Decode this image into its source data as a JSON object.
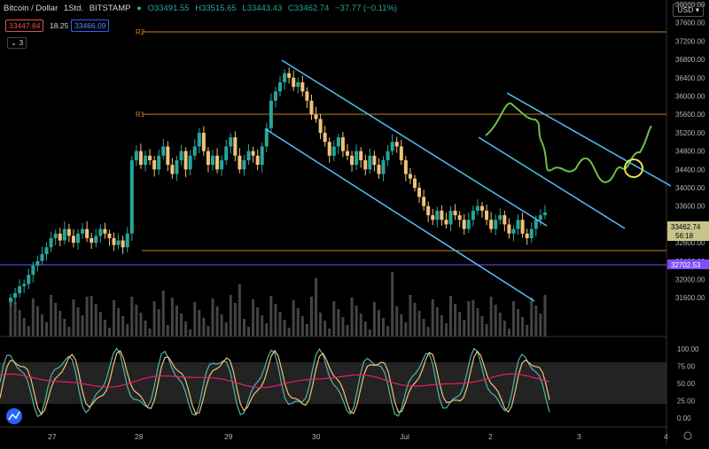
{
  "header": {
    "symbol": "Bitcoin / Dollar",
    "interval": "1Std.",
    "exchange": "BITSTAMP",
    "open": "O33491.55",
    "high": "H33515.65",
    "low": "L33443.43",
    "close": "C33462.74",
    "change": "−37.77 (−0.11%)"
  },
  "quote": {
    "bid": "33447.84",
    "spread": "18.25",
    "ask": "33466.09",
    "indicators_count": "3"
  },
  "currency": "USD",
  "levels": {
    "r2": "R2",
    "r1": "R1"
  },
  "price_axis": {
    "ticks": [
      "38000.00",
      "37600.00",
      "37200.00",
      "36800.00",
      "36400.00",
      "36000.00",
      "35600.00",
      "35200.00",
      "34800.00",
      "34400.00",
      "34000.00",
      "33600.00",
      "33200.00",
      "32800.00",
      "32400.00",
      "32000.00",
      "31600.00"
    ],
    "last_price": "33462.74",
    "countdown": "56:18",
    "line_price": "32702.53"
  },
  "osc_axis": {
    "ticks": [
      "100.00",
      "75.00",
      "50.00",
      "25.00",
      "0.00"
    ]
  },
  "time_axis": {
    "labels": [
      "27",
      "28",
      "29",
      "30",
      "Jul",
      "2",
      "3",
      "4"
    ]
  },
  "colors": {
    "up": "#26a69a",
    "down": "#f0c27b",
    "channel": "#4fc3f7",
    "drawing": "#6cc04a",
    "level": "#c77c2e",
    "purple": "#7c4dff"
  },
  "chart_data": {
    "type": "candlestick",
    "y_range": [
      31400,
      38000
    ],
    "candles_per_day": 24,
    "days": [
      "27",
      "28",
      "29",
      "30",
      "Jul",
      "2",
      "3",
      "4"
    ],
    "closes": [
      31600,
      31700,
      31850,
      31900,
      32100,
      32300,
      32400,
      32550,
      32700,
      32900,
      33000,
      32850,
      33100,
      32950,
      32800,
      33000,
      33100,
      32900,
      32800,
      32950,
      33100,
      33000,
      32900,
      32750,
      32850,
      32700,
      33000,
      34600,
      34800,
      34500,
      34700,
      34600,
      34400,
      34700,
      34900,
      34500,
      34300,
      34600,
      34800,
      34400,
      34700,
      34900,
      35200,
      34800,
      34500,
      34700,
      34400,
      34600,
      34900,
      35100,
      34700,
      34400,
      34600,
      34800,
      34700,
      34500,
      34900,
      35300,
      35900,
      36100,
      36300,
      36500,
      36400,
      36200,
      36300,
      36100,
      35900,
      35600,
      35500,
      35200,
      35000,
      34700,
      34900,
      35100,
      34800,
      34700,
      34500,
      34800,
      34600,
      34400,
      34700,
      34500,
      34300,
      34600,
      34800,
      35000,
      34900,
      34600,
      34300,
      34200,
      34000,
      33800,
      33600,
      33400,
      33300,
      33500,
      33300,
      33200,
      33500,
      33400,
      33300,
      33100,
      33300,
      33500,
      33600,
      33500,
      33300,
      33100,
      33300,
      33400,
      33200,
      33000,
      33100,
      33300,
      33000,
      32900,
      33100,
      33300,
      33400,
      33460
    ]
  }
}
